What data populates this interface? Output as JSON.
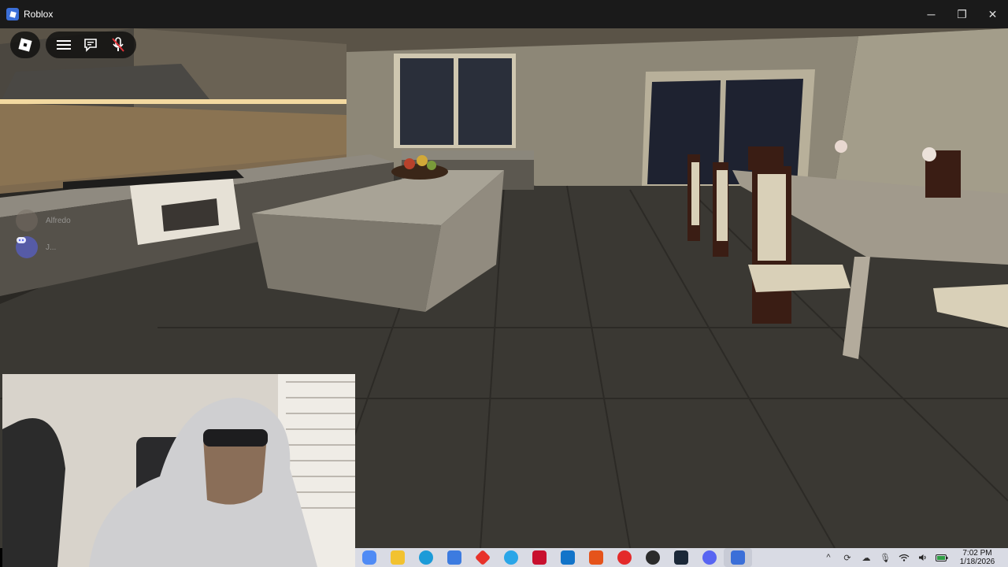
{
  "window": {
    "title": "Roblox",
    "minimize_glyph": "─",
    "maximize_glyph": "❐",
    "close_glyph": "✕"
  },
  "roblox_ui": {
    "menu_icon": "roblox-logo-icon",
    "controls": [
      "hamburger-menu-icon",
      "chat-icon",
      "microphone-muted-icon"
    ]
  },
  "voice_participants": [
    {
      "name": "Alfredo",
      "icon": "avatar-icon"
    },
    {
      "name": "J...",
      "icon": "discord-icon"
    }
  ],
  "taskbar": {
    "apps": [
      {
        "name": "copilot-icon",
        "color": "#4f8bf5"
      },
      {
        "name": "file-explorer-icon",
        "color": "#f2c230"
      },
      {
        "name": "edge-icon",
        "color": "#1c9bd8"
      },
      {
        "name": "microsoft-store-icon",
        "color": "#3c7be0"
      },
      {
        "name": "red-diamond-app-icon",
        "color": "#e8322a"
      },
      {
        "name": "browser-icon",
        "color": "#2aa6e8"
      },
      {
        "name": "mcafee-icon",
        "color": "#c8102e"
      },
      {
        "name": "outlook-icon",
        "color": "#1274c9"
      },
      {
        "name": "office-icon",
        "color": "#e5531b"
      },
      {
        "name": "red-app-icon",
        "color": "#e42a2a"
      },
      {
        "name": "obs-icon",
        "color": "#2b2b2b"
      },
      {
        "name": "steam-icon",
        "color": "#1b2838"
      },
      {
        "name": "discord-icon",
        "color": "#5865f2"
      },
      {
        "name": "roblox-icon",
        "color": "#3b6fd8"
      }
    ],
    "tray": {
      "chevron": "^",
      "time": "7:02 PM",
      "date": "1/18/2026"
    }
  }
}
